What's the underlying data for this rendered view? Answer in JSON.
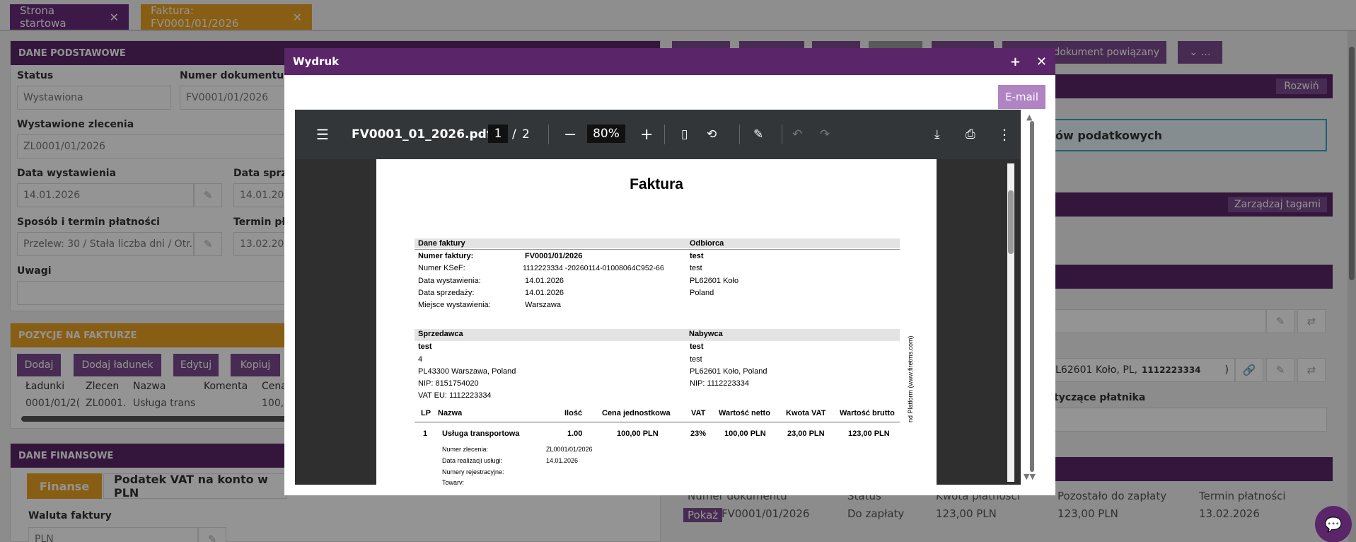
{
  "tabs": [
    {
      "label": "Strona startowa"
    },
    {
      "label": "Faktura: FV0001/01/2026"
    }
  ],
  "basic": {
    "header": "DANE PODSTAWOWE",
    "status_label": "Status",
    "status_value": "Wystawiona",
    "docnum_label": "Numer dokumentu",
    "docnum_value": "FV0001/01/2026",
    "orders_label": "Wystawione zlecenia",
    "orders_value": "ZL0001/01/2026",
    "issue_label": "Data wystawienia",
    "issue_value": "14.01.2026",
    "sale_label": "Data sprzed",
    "sale_value": "14.01.202",
    "payment_label": "Sposób i termin płatności",
    "payment_value": "Przelew: 30 / Stała liczba dni / Otr.",
    "due_label": "Termin pła",
    "due_value": "13.02.202",
    "notes_label": "Uwagi"
  },
  "items": {
    "header": "POZYCJE NA FAKTURZE",
    "buttons": [
      "Dodaj",
      "Dodaj ładunek",
      "Edytuj",
      "Kopiuj"
    ],
    "columns": [
      "Ładunki",
      "Zlecen",
      "Nazwa",
      "Komenta",
      "Cena"
    ],
    "row": [
      "0001/01/2(",
      "ZL0001.",
      "Usługa trans",
      "",
      "100,0"
    ]
  },
  "finance": {
    "header": "DANE FINANSOWE",
    "tab_active": "Finanse",
    "tab_other": "Podatek VAT na konto w PLN",
    "currency_label": "Waluta faktury",
    "currency_value": "PLN"
  },
  "right": {
    "related_btn": "z dokument powiązany",
    "expand_btn": "Rozwiń",
    "tax_text": "ów podatkowych",
    "tags_btn": "Zarządzaj tagami",
    "address_text": ", PL62601 Koło, PL,",
    "address_nip": "1112223334",
    "payer_label": "tyczące płatnika",
    "payments_cols": [
      "Numer dokumentu",
      "Status",
      "Kwota płatności",
      "Pozostało do zapłaty",
      "Termin płatności"
    ],
    "payments_row": {
      "show": "Pokaż",
      "doc": "FV0001/01/2026",
      "status": "Do zapłaty",
      "amount": "123,00 PLN",
      "remaining": "123,00 PLN",
      "due": "13.02.2026"
    }
  },
  "modal": {
    "title": "Wydruk",
    "email": "E-mail",
    "viewer": {
      "filename": "FV0001_01_2026.pdf",
      "page": "1",
      "pages": "2",
      "zoom": "80%"
    }
  },
  "pdf": {
    "title": "Faktura",
    "dane_h": "Dane faktury",
    "odbiorca_h": "Odbiorca",
    "fields": [
      {
        "k": "Numer faktury:",
        "v": "FV0001/01/2026"
      },
      {
        "k": "Numer KSeF:",
        "v": "1112223334 -20260114-01008064C952-66"
      },
      {
        "k": "Data wystawienia:",
        "v": "14.01.2026"
      },
      {
        "k": "Data sprzedaży:",
        "v": "14.01.2026"
      },
      {
        "k": "Miejsce wystawienia:",
        "v": "Warszawa"
      }
    ],
    "odbiorca": [
      "test",
      "test",
      "PL62601 Koło",
      "Poland"
    ],
    "sprzedawca_h": "Sprzedawca",
    "nabywca_h": "Nabywca",
    "sprzedawca": [
      "test",
      "4",
      "PL43300 Warszawa, Poland",
      "NIP: 8151754020",
      "VAT EU: 1112223334"
    ],
    "nabywca": [
      "test",
      "test",
      "PL62601 Koło, Poland",
      "NIP: 1112223334"
    ],
    "cols": [
      "LP",
      "Nazwa",
      "Ilość",
      "Cena jednostkowa",
      "VAT",
      "Wartość netto",
      "Kwota VAT",
      "Wartość brutto"
    ],
    "row": [
      "1",
      "Usługa transportowa",
      "1.00",
      "100,00 PLN",
      "23%",
      "100,00 PLN",
      "23,00 PLN",
      "123,00 PLN"
    ],
    "sub": [
      {
        "k": "Numer zlecenia:",
        "v": "ZL0001/01/2026"
      },
      {
        "k": "Data realizacji usługi:",
        "v": "14.01.2026"
      },
      {
        "k": "Numery rejestracyjne:",
        "v": ""
      },
      {
        "k": "Towary:",
        "v": ""
      }
    ],
    "vertical": "nd Platform (www.firetms.com)"
  }
}
